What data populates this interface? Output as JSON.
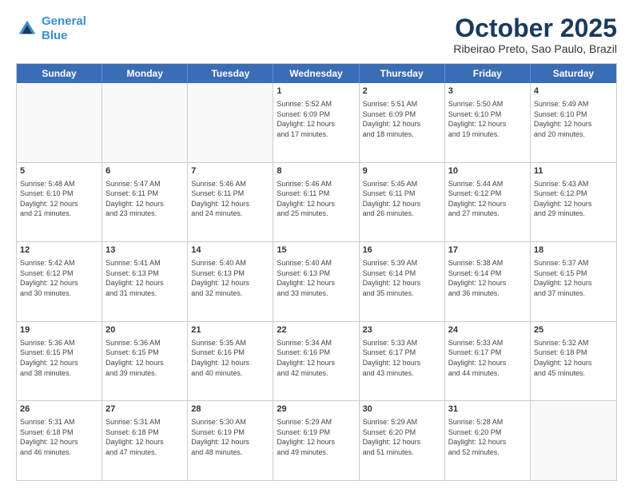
{
  "header": {
    "logo_line1": "General",
    "logo_line2": "Blue",
    "month_title": "October 2025",
    "location": "Ribeirao Preto, Sao Paulo, Brazil"
  },
  "days_of_week": [
    "Sunday",
    "Monday",
    "Tuesday",
    "Wednesday",
    "Thursday",
    "Friday",
    "Saturday"
  ],
  "weeks": [
    [
      {
        "day": "",
        "info": ""
      },
      {
        "day": "",
        "info": ""
      },
      {
        "day": "",
        "info": ""
      },
      {
        "day": "1",
        "info": "Sunrise: 5:52 AM\nSunset: 6:09 PM\nDaylight: 12 hours\nand 17 minutes."
      },
      {
        "day": "2",
        "info": "Sunrise: 5:51 AM\nSunset: 6:09 PM\nDaylight: 12 hours\nand 18 minutes."
      },
      {
        "day": "3",
        "info": "Sunrise: 5:50 AM\nSunset: 6:10 PM\nDaylight: 12 hours\nand 19 minutes."
      },
      {
        "day": "4",
        "info": "Sunrise: 5:49 AM\nSunset: 6:10 PM\nDaylight: 12 hours\nand 20 minutes."
      }
    ],
    [
      {
        "day": "5",
        "info": "Sunrise: 5:48 AM\nSunset: 6:10 PM\nDaylight: 12 hours\nand 21 minutes."
      },
      {
        "day": "6",
        "info": "Sunrise: 5:47 AM\nSunset: 6:11 PM\nDaylight: 12 hours\nand 23 minutes."
      },
      {
        "day": "7",
        "info": "Sunrise: 5:46 AM\nSunset: 6:11 PM\nDaylight: 12 hours\nand 24 minutes."
      },
      {
        "day": "8",
        "info": "Sunrise: 5:46 AM\nSunset: 6:11 PM\nDaylight: 12 hours\nand 25 minutes."
      },
      {
        "day": "9",
        "info": "Sunrise: 5:45 AM\nSunset: 6:11 PM\nDaylight: 12 hours\nand 26 minutes."
      },
      {
        "day": "10",
        "info": "Sunrise: 5:44 AM\nSunset: 6:12 PM\nDaylight: 12 hours\nand 27 minutes."
      },
      {
        "day": "11",
        "info": "Sunrise: 5:43 AM\nSunset: 6:12 PM\nDaylight: 12 hours\nand 29 minutes."
      }
    ],
    [
      {
        "day": "12",
        "info": "Sunrise: 5:42 AM\nSunset: 6:12 PM\nDaylight: 12 hours\nand 30 minutes."
      },
      {
        "day": "13",
        "info": "Sunrise: 5:41 AM\nSunset: 6:13 PM\nDaylight: 12 hours\nand 31 minutes."
      },
      {
        "day": "14",
        "info": "Sunrise: 5:40 AM\nSunset: 6:13 PM\nDaylight: 12 hours\nand 32 minutes."
      },
      {
        "day": "15",
        "info": "Sunrise: 5:40 AM\nSunset: 6:13 PM\nDaylight: 12 hours\nand 33 minutes."
      },
      {
        "day": "16",
        "info": "Sunrise: 5:39 AM\nSunset: 6:14 PM\nDaylight: 12 hours\nand 35 minutes."
      },
      {
        "day": "17",
        "info": "Sunrise: 5:38 AM\nSunset: 6:14 PM\nDaylight: 12 hours\nand 36 minutes."
      },
      {
        "day": "18",
        "info": "Sunrise: 5:37 AM\nSunset: 6:15 PM\nDaylight: 12 hours\nand 37 minutes."
      }
    ],
    [
      {
        "day": "19",
        "info": "Sunrise: 5:36 AM\nSunset: 6:15 PM\nDaylight: 12 hours\nand 38 minutes."
      },
      {
        "day": "20",
        "info": "Sunrise: 5:36 AM\nSunset: 6:15 PM\nDaylight: 12 hours\nand 39 minutes."
      },
      {
        "day": "21",
        "info": "Sunrise: 5:35 AM\nSunset: 6:16 PM\nDaylight: 12 hours\nand 40 minutes."
      },
      {
        "day": "22",
        "info": "Sunrise: 5:34 AM\nSunset: 6:16 PM\nDaylight: 12 hours\nand 42 minutes."
      },
      {
        "day": "23",
        "info": "Sunrise: 5:33 AM\nSunset: 6:17 PM\nDaylight: 12 hours\nand 43 minutes."
      },
      {
        "day": "24",
        "info": "Sunrise: 5:33 AM\nSunset: 6:17 PM\nDaylight: 12 hours\nand 44 minutes."
      },
      {
        "day": "25",
        "info": "Sunrise: 5:32 AM\nSunset: 6:18 PM\nDaylight: 12 hours\nand 45 minutes."
      }
    ],
    [
      {
        "day": "26",
        "info": "Sunrise: 5:31 AM\nSunset: 6:18 PM\nDaylight: 12 hours\nand 46 minutes."
      },
      {
        "day": "27",
        "info": "Sunrise: 5:31 AM\nSunset: 6:18 PM\nDaylight: 12 hours\nand 47 minutes."
      },
      {
        "day": "28",
        "info": "Sunrise: 5:30 AM\nSunset: 6:19 PM\nDaylight: 12 hours\nand 48 minutes."
      },
      {
        "day": "29",
        "info": "Sunrise: 5:29 AM\nSunset: 6:19 PM\nDaylight: 12 hours\nand 49 minutes."
      },
      {
        "day": "30",
        "info": "Sunrise: 5:29 AM\nSunset: 6:20 PM\nDaylight: 12 hours\nand 51 minutes."
      },
      {
        "day": "31",
        "info": "Sunrise: 5:28 AM\nSunset: 6:20 PM\nDaylight: 12 hours\nand 52 minutes."
      },
      {
        "day": "",
        "info": ""
      }
    ]
  ]
}
